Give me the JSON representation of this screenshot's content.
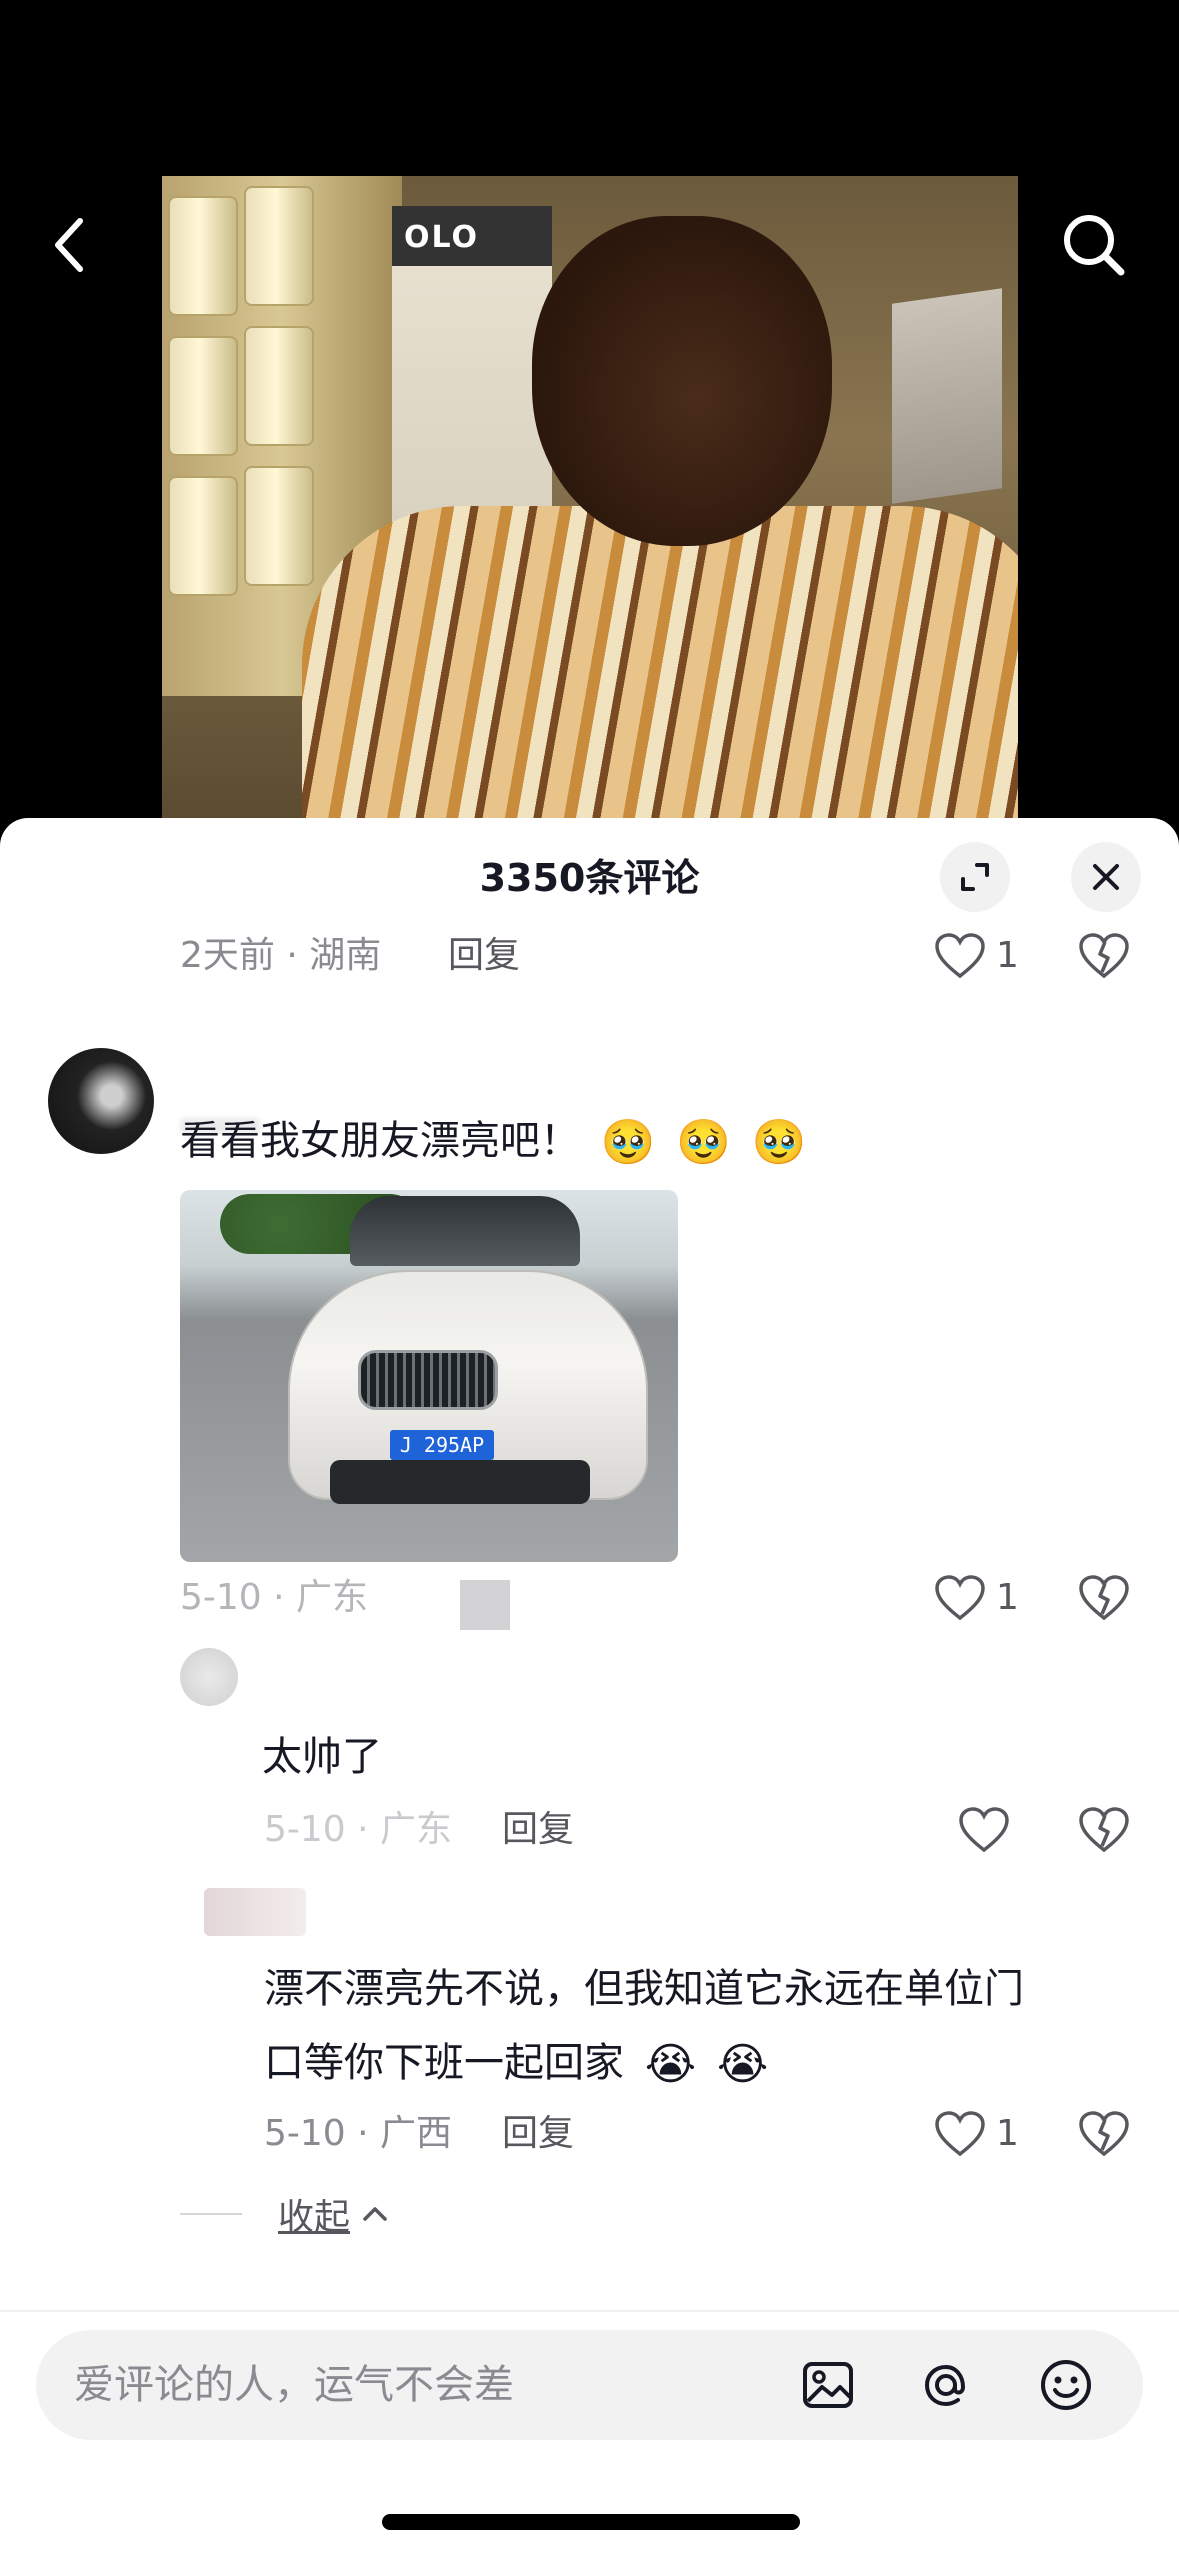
{
  "video": {
    "poster_text": "OLO"
  },
  "nav": {
    "back_icon": "chevron-left-icon",
    "search_icon": "search-icon"
  },
  "sheet": {
    "title": "3350条评论"
  },
  "prev_comment": {
    "meta": "2天前 · 湖南",
    "reply": "回复",
    "likes": "1"
  },
  "main_comment": {
    "text": "看看我女朋友漂亮吧！",
    "emojis": [
      "🥹",
      "🥹",
      "🥹"
    ],
    "plate": "J 295AP",
    "meta": "5-10 · 广东",
    "likes": "1"
  },
  "replies": [
    {
      "text": "太帅了",
      "meta": "5-10 · 广东",
      "reply": "回复",
      "likes": ""
    },
    {
      "text_line1": "漂不漂亮先不说，但我知道它永远在单位门",
      "text_line2": "口等你下班一起回家",
      "emojis": [
        "😭",
        "😭"
      ],
      "meta": "5-10 · 广西",
      "reply": "回复",
      "likes": "1"
    }
  ],
  "collapse": {
    "label": "收起",
    "icon": "chevron-up-icon"
  },
  "input": {
    "placeholder": "爱评论的人，运气不会差"
  }
}
